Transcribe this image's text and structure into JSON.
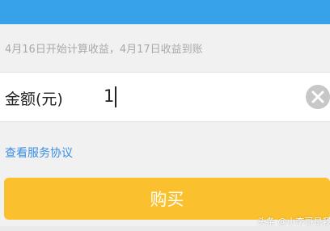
{
  "header": {
    "bar_color": "#37a2ea"
  },
  "notice": {
    "text": "4月16日开始计算收益，4月17日收益到账"
  },
  "amount": {
    "label": "金额(元)",
    "value": "1",
    "clear_icon": "clear-circle-icon"
  },
  "agreement": {
    "link_text": "查看服务协议",
    "color": "#3a8ee6"
  },
  "buy": {
    "label": "购买",
    "color": "#fbc02d"
  },
  "watermark": {
    "text": "头条 @小李哥是我"
  }
}
